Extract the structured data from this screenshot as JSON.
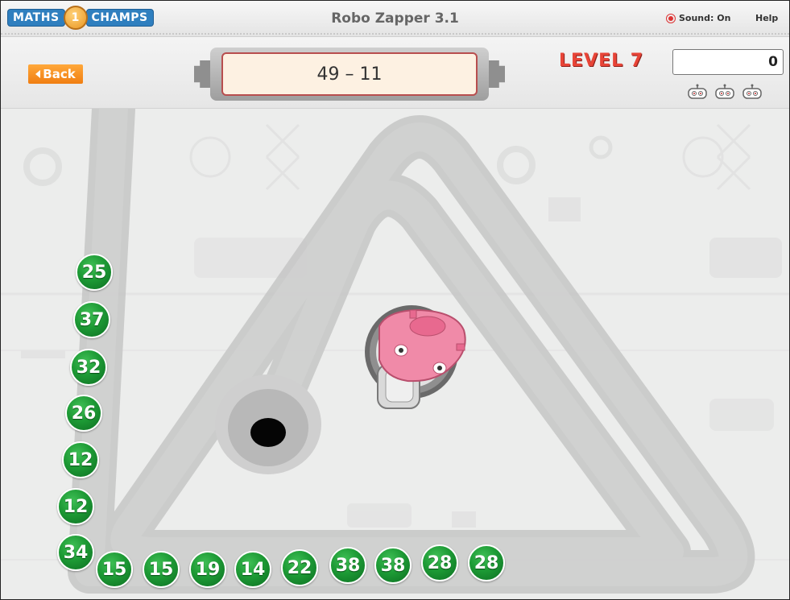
{
  "header": {
    "logo_left": "MATHS",
    "logo_right": "CHAMPS",
    "title": "Robo Zapper 3.1",
    "sound_label": "Sound: On",
    "help_label": "Help"
  },
  "toolbar": {
    "back_label": "Back",
    "question": "49 – 11",
    "level_label": "LEVEL 7",
    "score": "0",
    "lives_count": 3
  },
  "chain": {
    "vertical_balls": [
      "25",
      "37",
      "32",
      "26",
      "12",
      "12",
      "34"
    ],
    "horizontal_balls": [
      "15",
      "15",
      "19",
      "14",
      "22",
      "38",
      "38",
      "28",
      "28"
    ]
  },
  "colors": {
    "ball": "#1d9a35",
    "back_button": "#f07e12",
    "level_text": "#e84437",
    "question_border": "#b84e4e",
    "robot": "#f08aa8",
    "track": "#c8c8c8"
  },
  "icons": {
    "robot": "robot-shooter-icon",
    "hole": "end-hole-icon",
    "life": "robot-life-icon",
    "sound": "sound-toggle-icon"
  }
}
